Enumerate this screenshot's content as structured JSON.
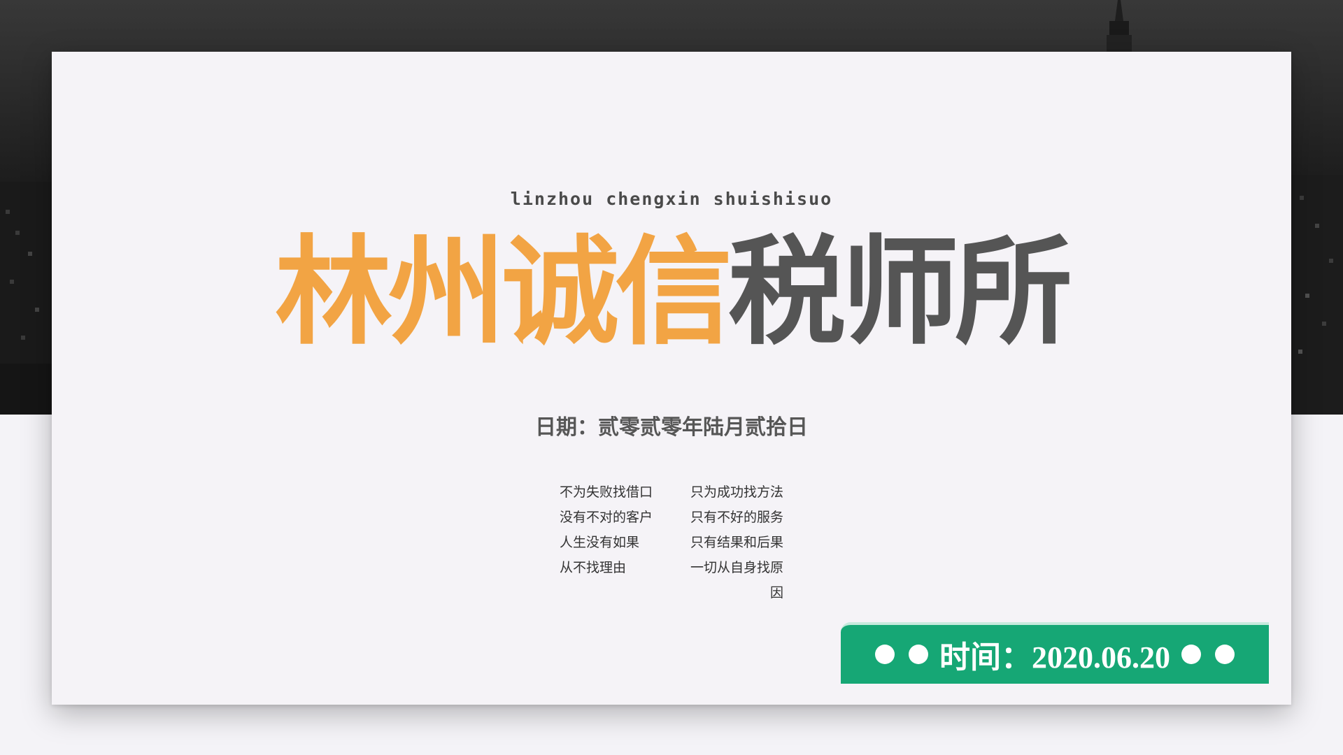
{
  "background": {
    "photo_description_icon": "city-skyline-image",
    "dark_color": "#2a2a2a",
    "light_color": "#f4f3f7"
  },
  "card": {
    "subtitle_en": "linzhou chengxin shuishisuo",
    "title_orange": "林州诚信",
    "title_gray": "税师所",
    "date_line": "日期：贰零贰零年陆月贰拾日",
    "mottos": [
      {
        "left": "不为失败找借口",
        "right": "只为成功找方法"
      },
      {
        "left": "没有不对的客户",
        "right": "只有不好的服务"
      },
      {
        "left": "人生没有如果",
        "right": "只有结果和后果"
      },
      {
        "left": "从不找理由",
        "right": "一切从自身找原因"
      }
    ]
  },
  "time_banner": {
    "text": "时间：2020.06.20",
    "color": "#16a775"
  },
  "colors": {
    "title_orange": "#f2a444",
    "title_gray": "#555555"
  }
}
